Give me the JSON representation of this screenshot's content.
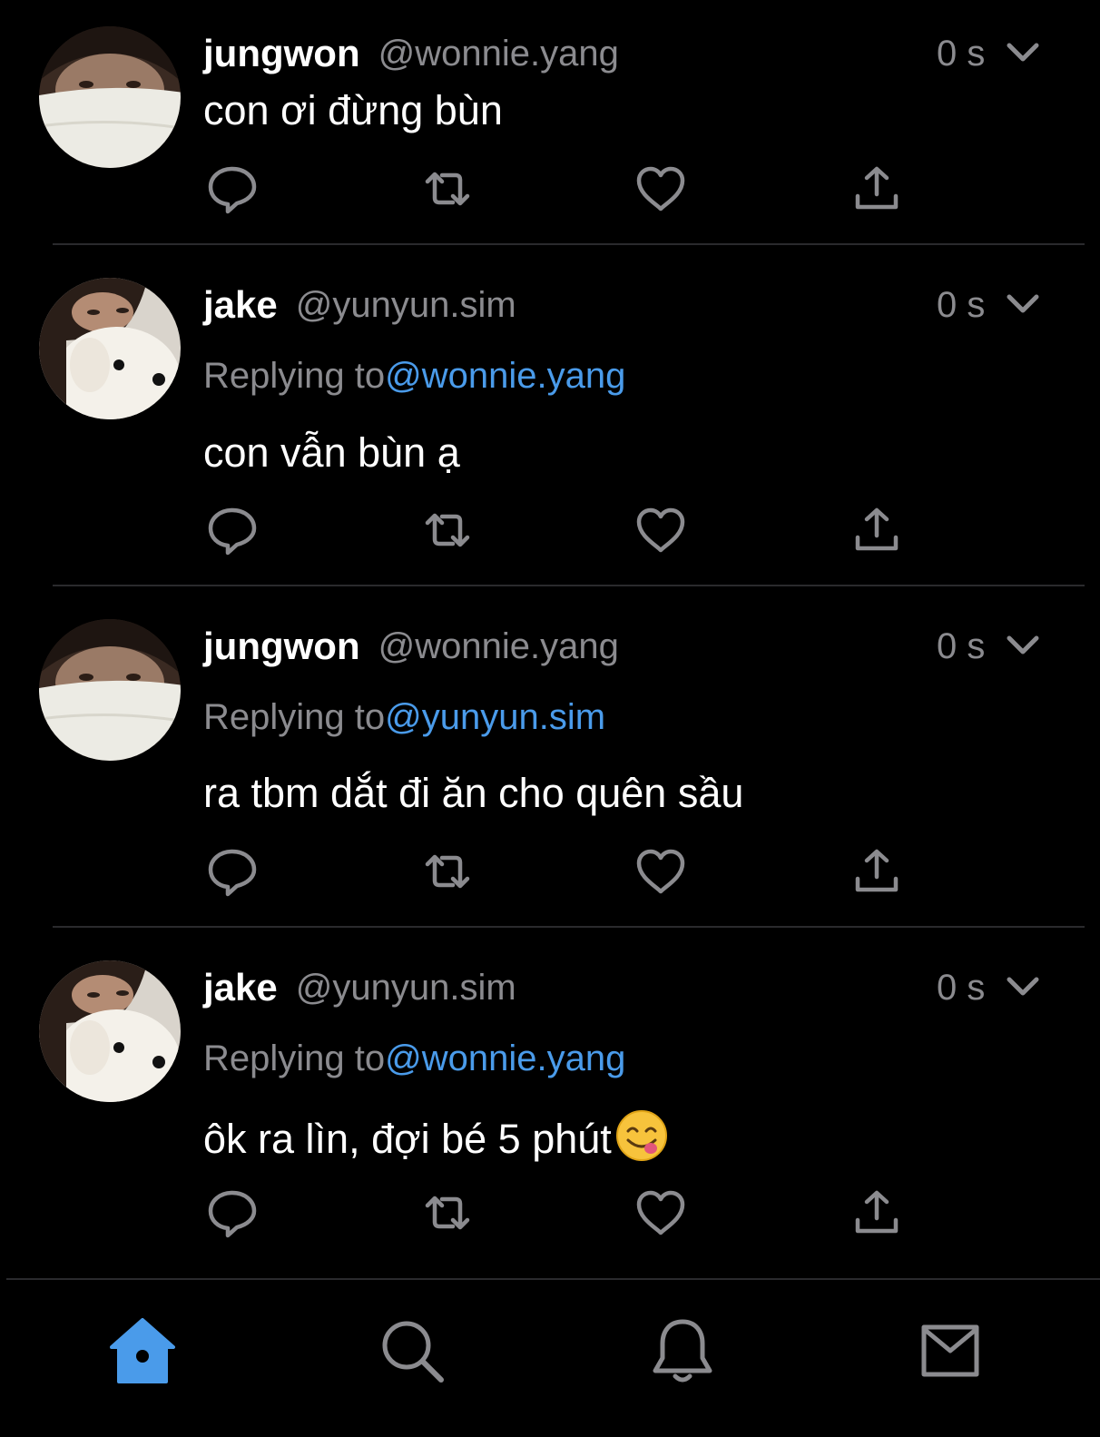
{
  "colors": {
    "background": "#000000",
    "text_primary": "#ffffff",
    "text_secondary": "#8b8b8f",
    "accent": "#4a9bea",
    "divider": "#2a2a2d"
  },
  "tweets": [
    {
      "name": "jungwon",
      "handle": "@wonnie.yang",
      "time": "0 s",
      "avatar": "avatar-jungwon",
      "reply_prefix": "",
      "reply_to": "",
      "text": "con ơi đừng bùn"
    },
    {
      "name": "jake",
      "handle": "@yunyun.sim",
      "time": "0 s",
      "avatar": "avatar-jake",
      "reply_prefix": "Replying to",
      "reply_to": "@wonnie.yang",
      "text": "con vẫn bùn ạ"
    },
    {
      "name": "jungwon",
      "handle": "@wonnie.yang",
      "time": "0 s",
      "avatar": "avatar-jungwon",
      "reply_prefix": "Replying to",
      "reply_to": "@yunyun.sim",
      "text": "ra tbm dắt đi ăn cho quên sầu"
    },
    {
      "name": "jake",
      "handle": "@yunyun.sim",
      "time": "0 s",
      "avatar": "avatar-jake",
      "reply_prefix": "Replying to",
      "reply_to": "@wonnie.yang",
      "text": "ôk ra lìn, đợi bé 5 phút",
      "emoji": "savoring-face-emoji"
    }
  ],
  "action_icons": [
    "reply-icon",
    "retweet-icon",
    "like-icon",
    "share-icon"
  ],
  "tabbar": {
    "tabs": [
      {
        "icon": "home-icon",
        "active": true
      },
      {
        "icon": "search-icon",
        "active": false
      },
      {
        "icon": "bell-icon",
        "active": false
      },
      {
        "icon": "mail-icon",
        "active": false
      }
    ]
  }
}
